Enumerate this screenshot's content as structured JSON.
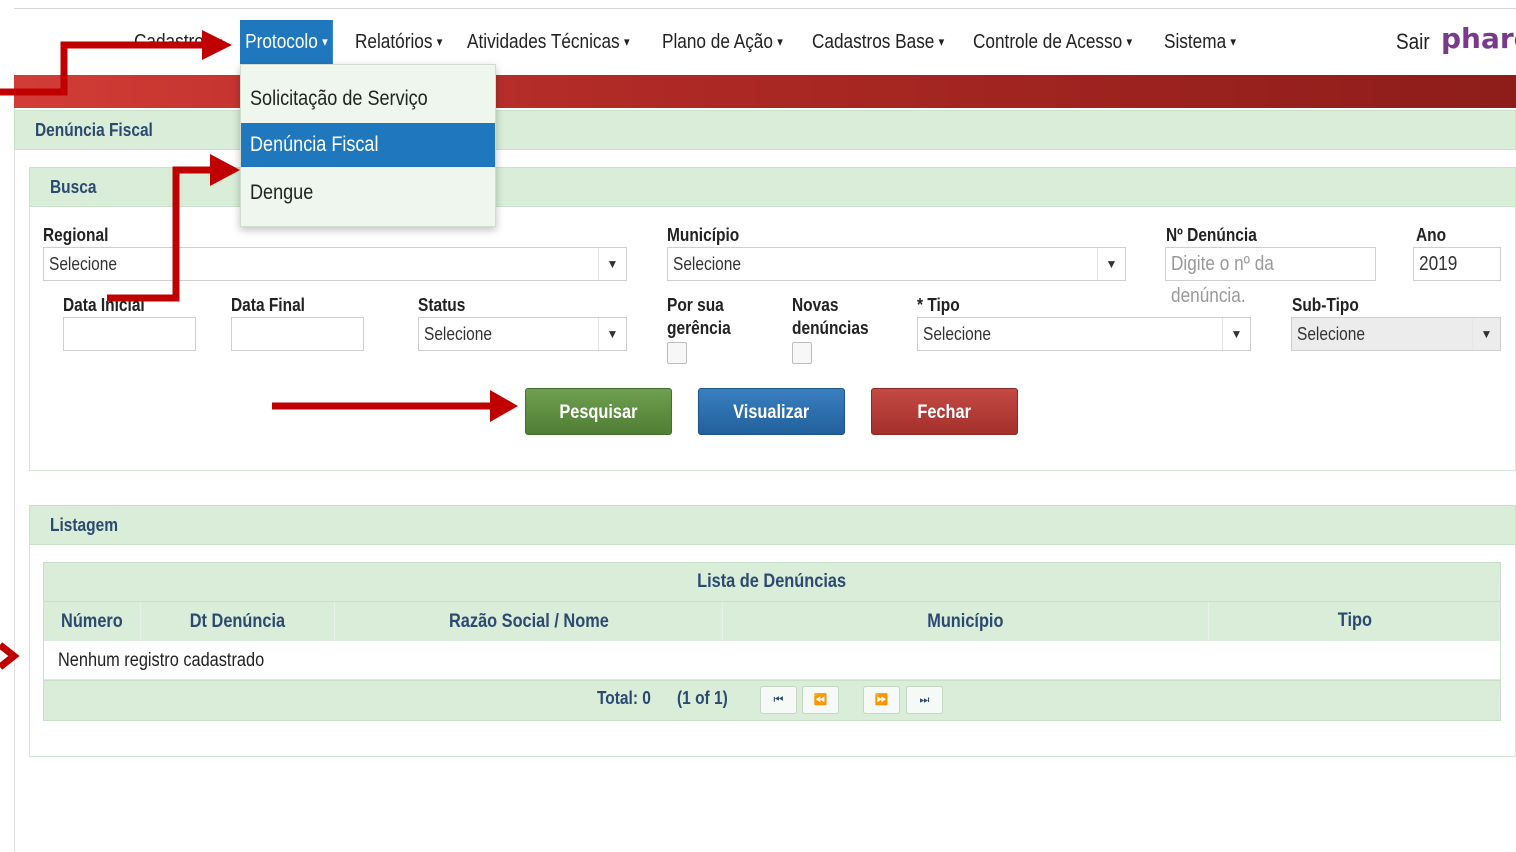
{
  "nav": {
    "items": [
      {
        "label": "Cadastros",
        "caret": "▾"
      },
      {
        "label": "Protocolo",
        "caret": "▾"
      },
      {
        "label": "Relatórios",
        "caret": "▾"
      },
      {
        "label": "Atividades Técnicas",
        "caret": "▾"
      },
      {
        "label": "Plano de Ação",
        "caret": "▾"
      },
      {
        "label": "Cadastros Base",
        "caret": "▾"
      },
      {
        "label": "Controle de Acesso",
        "caret": "▾"
      },
      {
        "label": "Sistema",
        "caret": "▾"
      }
    ],
    "logout_label": "Sair",
    "logo_text": "pharos"
  },
  "dropdown": {
    "items": [
      {
        "label": "Solicitação de Serviço"
      },
      {
        "label": "Denúncia Fiscal"
      },
      {
        "label": "Dengue"
      }
    ]
  },
  "page": {
    "title": "Denúncia Fiscal"
  },
  "busca": {
    "title": "Busca",
    "regional": {
      "label": "Regional",
      "value": "Selecione"
    },
    "municipio": {
      "label": "Município",
      "value": "Selecione"
    },
    "numero": {
      "label": "Nº Denúncia",
      "placeholder": "Digite o nº da denúncia."
    },
    "ano": {
      "label": "Ano",
      "value": "2019"
    },
    "data_inicial": {
      "label": "Data Inicial",
      "value": ""
    },
    "data_final": {
      "label": "Data Final",
      "value": ""
    },
    "status": {
      "label": "Status",
      "value": "Selecione"
    },
    "por_sua_gerencia": {
      "label_line1": "Por sua",
      "label_line2": "gerência",
      "checked": false
    },
    "novas_denuncias": {
      "label_line1": "Novas",
      "label_line2": "denúncias",
      "checked": false
    },
    "tipo": {
      "label": "* Tipo",
      "value": "Selecione"
    },
    "sub_tipo": {
      "label": "Sub-Tipo",
      "value": "Selecione"
    },
    "buttons": {
      "pesquisar": "Pesquisar",
      "visualizar": "Visualizar",
      "fechar": "Fechar"
    }
  },
  "listagem": {
    "title": "Listagem",
    "table_title": "Lista de Denúncias",
    "columns": [
      "Número",
      "Dt Denúncia",
      "Razão Social / Nome",
      "Município",
      "Tipo"
    ],
    "empty_message": "Nenhum registro cadastrado",
    "total_label": "Total: 0",
    "page_info": "(1 of 1)",
    "pager": {
      "first": "⏮",
      "prev": "⏪",
      "next": "⏩",
      "last": "⏭"
    }
  },
  "colors": {
    "nav_active": "#1f78be",
    "red_bar": "#b02a26",
    "panel_header": "#d9edd9",
    "btn_pesquisar": "#5b8c3e",
    "btn_visualizar": "#2a6aa8",
    "btn_fechar": "#b33834",
    "annotation_arrow": "#c00000"
  }
}
